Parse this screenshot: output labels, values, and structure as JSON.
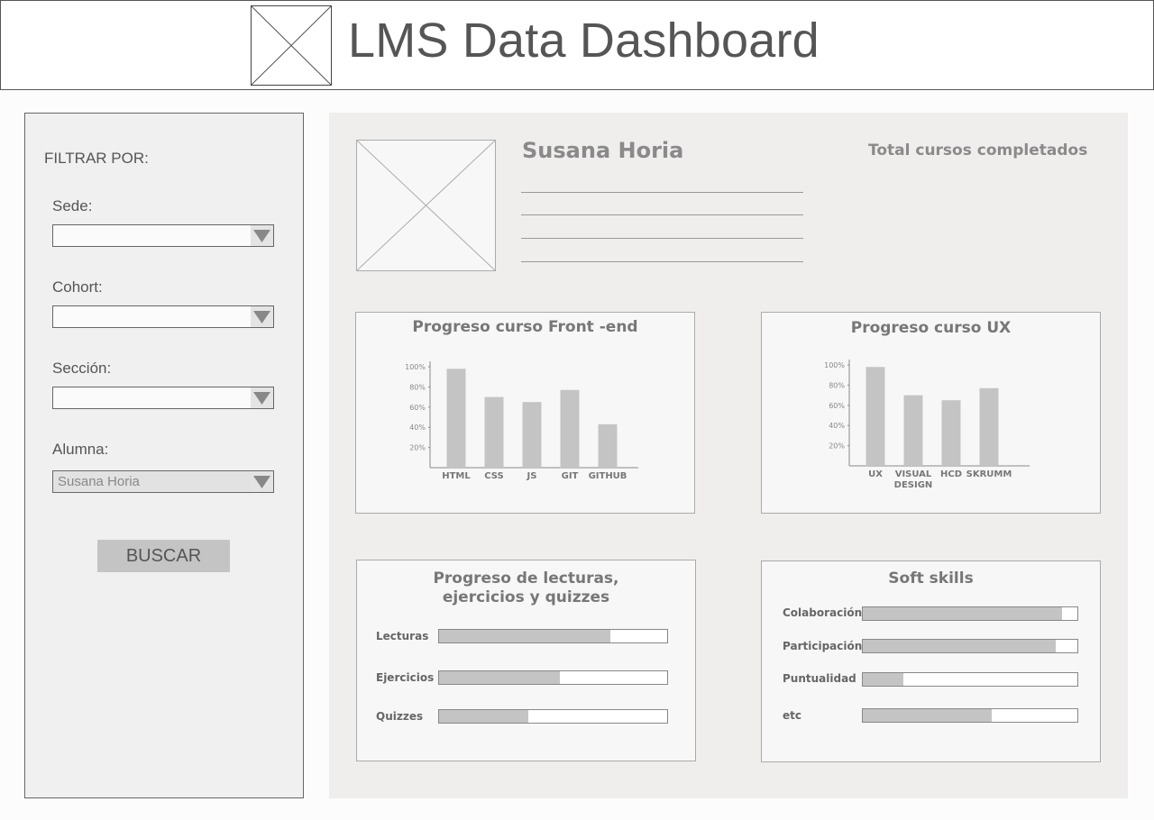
{
  "app": {
    "title": "LMS Data Dashboard",
    "logo_icon": "image-placeholder-icon"
  },
  "sidebar": {
    "heading": "FILTRAR POR:",
    "filters": [
      {
        "label": "Sede:",
        "value": ""
      },
      {
        "label": "Cohort:",
        "value": ""
      },
      {
        "label": "Sección:",
        "value": ""
      },
      {
        "label": "Alumna:",
        "value": "Susana Horia"
      }
    ],
    "search_button": "BUSCAR"
  },
  "profile": {
    "name": "Susana Horia",
    "photo_icon": "image-placeholder-icon",
    "total_label": "Total cursos completados"
  },
  "charts": {
    "frontend": {
      "title": "Progreso curso Front -end"
    },
    "ux": {
      "title": "Progreso curso UX"
    }
  },
  "chart_data": [
    {
      "type": "bar",
      "title": "Progreso curso Front -end",
      "categories": [
        "HTML",
        "CSS",
        "JS",
        "GIT",
        "GITHUB"
      ],
      "values": [
        98,
        70,
        65,
        77,
        43
      ],
      "yticks": [
        "20%",
        "40%",
        "60%",
        "80%",
        "100%"
      ]
    },
    {
      "type": "bar",
      "title": "Progreso curso UX",
      "categories": [
        "UX",
        "VISUAL DESIGN",
        "HCD",
        "SKRUMM"
      ],
      "values": [
        98,
        70,
        65,
        77
      ],
      "yticks": [
        "20%",
        "40%",
        "60%",
        "80%",
        "100%"
      ]
    }
  ],
  "readings": {
    "title_line1": "Progreso de lecturas,",
    "title_line2": "ejercicios y quizzes",
    "rows": [
      {
        "label": "Lecturas",
        "fraction": 0.75
      },
      {
        "label": "Ejercicios",
        "fraction": 0.53
      },
      {
        "label": "Quizzes",
        "fraction": 0.39
      }
    ]
  },
  "soft_skills": {
    "title": "Soft skills",
    "rows": [
      {
        "label": "Colaboración",
        "fraction": 0.93
      },
      {
        "label": "Participación",
        "fraction": 0.9
      },
      {
        "label": "Puntualidad",
        "fraction": 0.19
      },
      {
        "label": "etc",
        "fraction": 0.6
      }
    ]
  },
  "colors": {
    "bar": "#c4c4c4",
    "panel": "#f0eded",
    "border": "#aaaaaa"
  }
}
